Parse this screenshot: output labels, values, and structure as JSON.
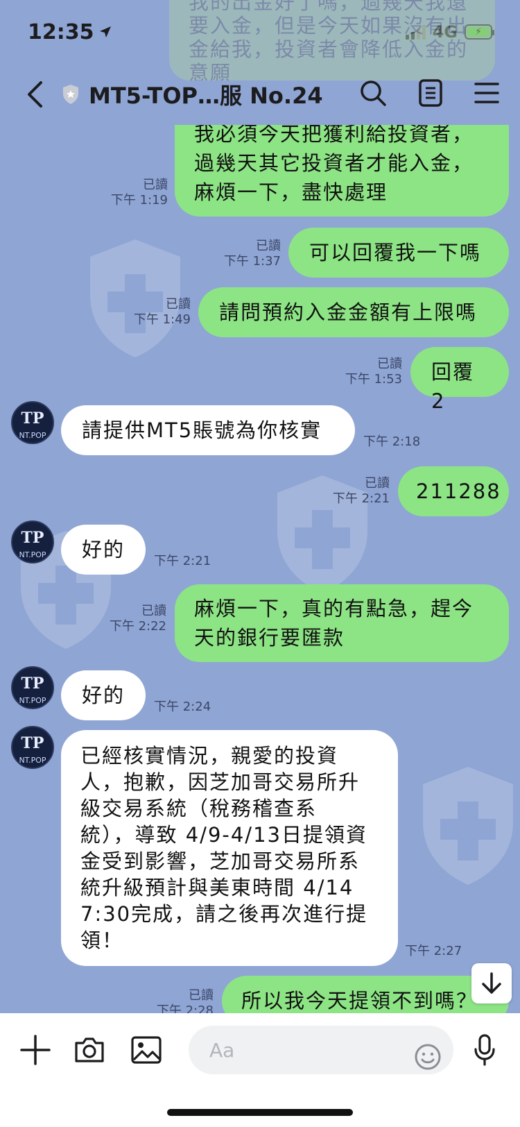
{
  "status": {
    "time": "12:35",
    "network": "4G"
  },
  "header": {
    "title": "MT5-TOP…服 No.24"
  },
  "messages": [
    {
      "side": "out",
      "text": "我必須今天把獲利給投資者，\n過幾天其它投資者才能入金，\n麻煩一下，盡快處理",
      "read": "已讀",
      "time": "下午 1:19"
    },
    {
      "side": "out",
      "text": "可以回覆我一下嗎",
      "read": "已讀",
      "time": "下午 1:37"
    },
    {
      "side": "out",
      "text": "請問預約入金金額有上限嗎",
      "read": "已讀",
      "time": "下午 1:49"
    },
    {
      "side": "out",
      "text": "回覆 2",
      "read": "已讀",
      "time": "下午 1:53"
    },
    {
      "side": "in",
      "text": "請提供MT5賬號為你核實",
      "time": "下午 2:18"
    },
    {
      "side": "out",
      "text": "211288",
      "read": "已讀",
      "time": "下午 2:21"
    },
    {
      "side": "in",
      "text": "好的",
      "time": "下午 2:21"
    },
    {
      "side": "out",
      "text": "麻煩一下，真的有點急，趕今\n天的銀行要匯款",
      "read": "已讀",
      "time": "下午 2:22"
    },
    {
      "side": "in",
      "text": "好的",
      "time": "下午 2:24"
    },
    {
      "side": "in",
      "text": "已經核實情況，親愛的投資\n人，抱歉，因芝加哥交易所升\n級交易系統（稅務稽查系\n統），導致 4/9-4/13日提領資\n金受到影響，芝加哥交易所系\n統升級預計與美東時間 4/14\n7:30完成，請之後再次進行提\n領！",
      "time": "下午 2:27"
    },
    {
      "side": "out",
      "text": "所以我今天提領不到嗎？",
      "read": "已讀",
      "time": "下午 2:28"
    }
  ],
  "avatar": {
    "label": "NT.POP",
    "logo": "TP"
  },
  "top_fragment": {
    "text": "我的出金好了嗎，過幾天我還\n要入金，但是今天如果沒有出\n金給我，投資者會降低入金的\n意願"
  },
  "input": {
    "placeholder": "Aa"
  },
  "icons": [
    "back-icon",
    "shield-icon",
    "search-icon",
    "notes-icon",
    "menu-icon",
    "plus-icon",
    "camera-icon",
    "image-icon",
    "emoji-icon",
    "mic-icon",
    "arrow-down-icon"
  ],
  "colors": {
    "background": "#8fa5d4",
    "outgoing": "#8de485",
    "incoming": "#ffffff"
  }
}
